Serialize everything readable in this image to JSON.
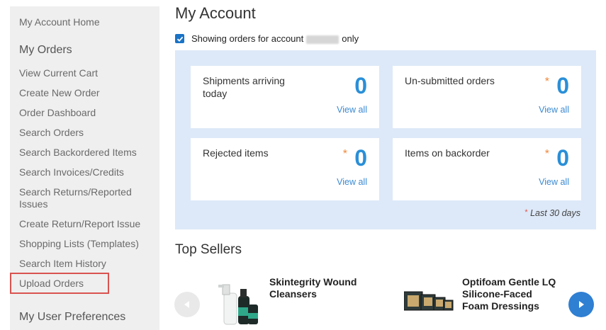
{
  "sidebar": {
    "home": "My Account Home",
    "orders_heading": "My Orders",
    "items": [
      "View Current Cart",
      "Create New Order",
      "Order Dashboard",
      "Search Orders",
      "Search Backordered Items",
      "Search Invoices/Credits",
      "Search Returns/Reported Issues",
      "Create Return/Report Issue",
      "Shopping Lists (Templates)",
      "Search Item History",
      "Upload Orders"
    ],
    "preferences_heading": "My User Preferences"
  },
  "header": {
    "title": "My Account"
  },
  "filter": {
    "prefix": "Showing orders for account",
    "suffix": "only",
    "checked": true
  },
  "dashboard": {
    "cards": [
      {
        "label": "Shipments arriving today",
        "count": "0",
        "link": "View all",
        "starred": false
      },
      {
        "label": "Un-submitted orders",
        "count": "0",
        "link": "View all",
        "starred": true
      },
      {
        "label": "Rejected items",
        "count": "0",
        "link": "View all",
        "starred": true
      },
      {
        "label": "Items on backorder",
        "count": "0",
        "link": "View all",
        "starred": true
      }
    ],
    "footnote_star": "*",
    "footnote": "Last 30 days",
    "star": "*"
  },
  "top_sellers": {
    "title": "Top Sellers",
    "products": [
      {
        "name": "Skintegrity Wound Cleansers"
      },
      {
        "name": "Optifoam Gentle LQ Silicone-Faced Foam Dressings"
      }
    ]
  },
  "colors": {
    "accent": "#2a8fd8",
    "panel": "#dde9f8",
    "highlight_border": "#d9534f",
    "star": "#f0883a"
  }
}
